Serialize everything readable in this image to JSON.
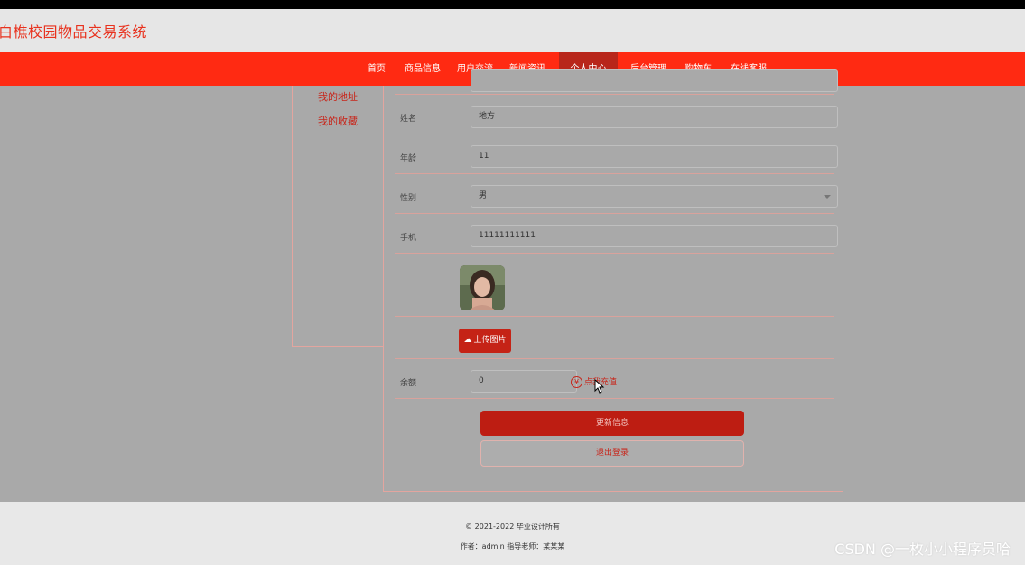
{
  "site": {
    "title": "白樵校园物品交易系统"
  },
  "nav": {
    "items": [
      {
        "label": "首页"
      },
      {
        "label": "商品信息"
      },
      {
        "label": "用户交流"
      },
      {
        "label": "新闻资讯"
      },
      {
        "label": "个人中心",
        "active": true
      },
      {
        "label": "后台管理"
      },
      {
        "label": "购物车"
      },
      {
        "label": "在线客服"
      }
    ]
  },
  "sidebar": {
    "items": [
      {
        "label": "我的地址"
      },
      {
        "label": "我的收藏"
      }
    ]
  },
  "form": {
    "name": {
      "label": "姓名",
      "value": "地方"
    },
    "age": {
      "label": "年龄",
      "value": "11"
    },
    "gender": {
      "label": "性别",
      "value": "男"
    },
    "phone": {
      "label": "手机",
      "value": "11111111111"
    },
    "upload": {
      "label": "上传图片"
    },
    "balance": {
      "label": "余额",
      "value": "0",
      "recharge_label": "点我充值"
    }
  },
  "actions": {
    "update_label": "更新信息",
    "logout_label": "退出登录"
  },
  "footer": {
    "copyright": "© 2021-2022 毕业设计所有",
    "author": "作者：admin 指导老师：某某某"
  },
  "watermark": "CSDN @一枚小小程序员哈",
  "colors": {
    "brand": "#ff2a12",
    "active_nav": "#b8261a",
    "button": "#bd1d12"
  }
}
